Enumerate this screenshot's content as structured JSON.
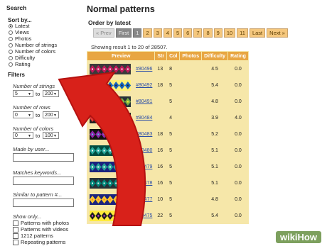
{
  "sidebar": {
    "title": "Search",
    "sort_heading": "Sort by...",
    "sort_options": [
      {
        "label": "Latest",
        "selected": true
      },
      {
        "label": "Views",
        "selected": false
      },
      {
        "label": "Photos",
        "selected": false
      },
      {
        "label": "Number of strings",
        "selected": false
      },
      {
        "label": "Number of colors",
        "selected": false
      },
      {
        "label": "Difficulty",
        "selected": false
      },
      {
        "label": "Rating",
        "selected": false
      }
    ],
    "filters_heading": "Filters",
    "strings_label": "Number of strings",
    "strings_min": "5",
    "strings_max": "200",
    "rows_label": "Number of rows",
    "rows_min": "0",
    "rows_max": "200",
    "colors_label": "Number of colors",
    "colors_min": "0",
    "colors_max": "100",
    "to_label": "to",
    "made_by_label": "Made by user...",
    "keywords_label": "Matches keywords...",
    "similar_label": "Similar to pattern #...",
    "show_only_label": "Show only...",
    "show_only_options": [
      "Patterns with photos",
      "Patterns with videos",
      "1212 patterns",
      "Repeating patterns"
    ]
  },
  "main": {
    "title": "Normal patterns",
    "order_label": "Order by latest",
    "pager": [
      "« Prev",
      "First",
      "1",
      "2",
      "3",
      "4",
      "5",
      "6",
      "7",
      "8",
      "9",
      "10",
      "11",
      "Last",
      "Next »"
    ],
    "showing": "Showing result 1 to 20 of 28507.",
    "columns": [
      "Preview",
      "Str",
      "Col",
      "Photos",
      "Difficulty",
      "Rating"
    ],
    "rows": [
      {
        "id": "#80496",
        "str": "13",
        "col": "8",
        "photos": "",
        "difficulty": "4.5",
        "rating": "0.0"
      },
      {
        "id": "#80492",
        "str": "18",
        "col": "5",
        "photos": "",
        "difficulty": "5.4",
        "rating": "0.0"
      },
      {
        "id": "#80491",
        "str": "",
        "col": "5",
        "photos": "",
        "difficulty": "4.8",
        "rating": "0.0"
      },
      {
        "id": "#80484",
        "str": "",
        "col": "4",
        "photos": "",
        "difficulty": "3.9",
        "rating": "4.0"
      },
      {
        "id": "#80483",
        "str": "18",
        "col": "5",
        "photos": "",
        "difficulty": "5.2",
        "rating": "0.0"
      },
      {
        "id": "#80480",
        "str": "16",
        "col": "5",
        "photos": "",
        "difficulty": "5.1",
        "rating": "0.0"
      },
      {
        "id": "#80479",
        "str": "16",
        "col": "5",
        "photos": "",
        "difficulty": "5.1",
        "rating": "0.0"
      },
      {
        "id": "#80478",
        "str": "16",
        "col": "5",
        "photos": "",
        "difficulty": "5.1",
        "rating": "0.0"
      },
      {
        "id": "#80477",
        "str": "10",
        "col": "5",
        "photos": "",
        "difficulty": "4.8",
        "rating": "0.0"
      },
      {
        "id": "#80475",
        "str": "22",
        "col": "5",
        "photos": "",
        "difficulty": "5.4",
        "rating": "0.0"
      }
    ]
  },
  "thumb_colors": [
    [
      "#c2185b",
      "#3a3a3a",
      "#f5f5f5"
    ],
    [
      "#1565c0",
      "#fff176",
      "#222222"
    ],
    [
      "#7cb342",
      "#263238",
      "#ffeb3b"
    ],
    [
      "#e53935",
      "#222222",
      "#ff80ab"
    ],
    [
      "#8e24aa",
      "#111111",
      "#4dd0e1"
    ],
    [
      "#26a69a",
      "#004d40",
      "#ffffff"
    ],
    [
      "#26a69a",
      "#1a237e",
      "#ffffff"
    ],
    [
      "#00897b",
      "#263238",
      "#e0f2f1"
    ],
    [
      "#ffca28",
      "#1a237e",
      "#ff7043"
    ],
    [
      "#212121",
      "#ffeb3b",
      "#e040fb"
    ]
  ],
  "colors": {
    "accent": "#e8a642",
    "arrow": "#d8211a",
    "watermark": "#7da05e"
  },
  "watermark": {
    "wiki": "wiki",
    "how": "How"
  }
}
